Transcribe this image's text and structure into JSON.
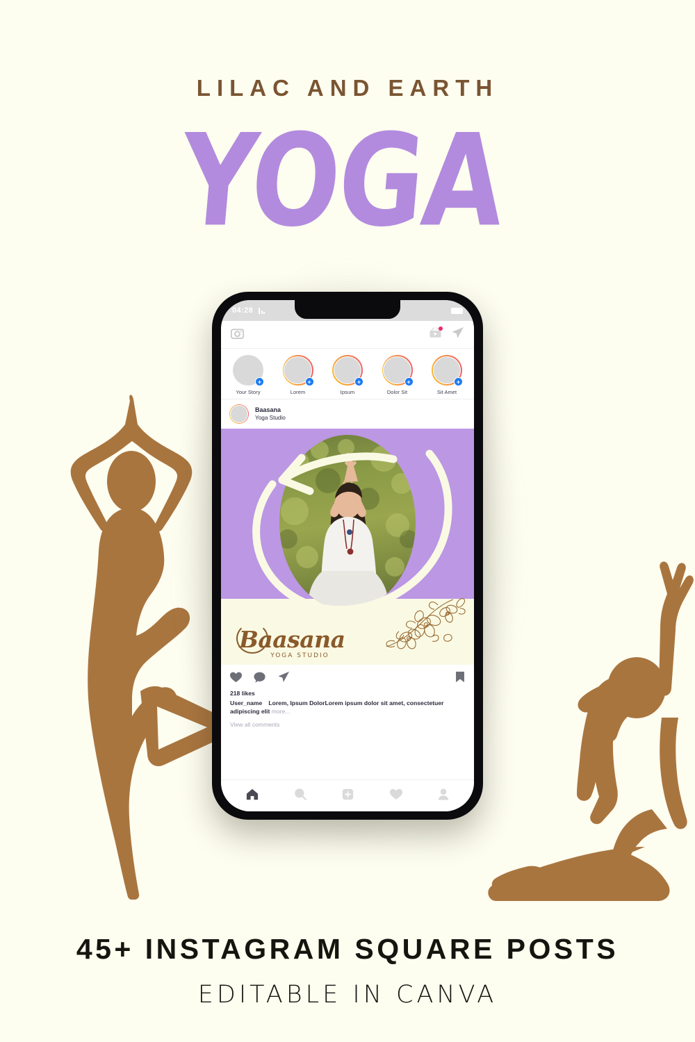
{
  "poster": {
    "kicker": "LILAC AND EARTH",
    "headline": "YOGA",
    "footer_main": "45+ INSTAGRAM SQUARE POSTS",
    "footer_sub": "EDITABLE IN CANVA",
    "colors": {
      "background": "#FDFDF0",
      "brown": "#7A5533",
      "lilac": "#B28BDE",
      "post_purple": "#BC97E4",
      "post_cream": "#FAFAE4",
      "silhouette": "#A9753F",
      "ink": "#15150F"
    }
  },
  "phone": {
    "status_bar": {
      "time": "04:28",
      "signal_icon": "signal-bars-icon",
      "battery_icon": "battery-icon"
    }
  },
  "instagram": {
    "top_bar": {
      "camera_icon": "camera-icon",
      "igtv_icon": "igtv-icon",
      "igtv_has_badge": true,
      "messenger_icon": "paper-plane-icon"
    },
    "stories": [
      {
        "label": "Your Story",
        "has_ring": false,
        "has_plus": true
      },
      {
        "label": "Lorem",
        "has_ring": true,
        "has_plus": true
      },
      {
        "label": "Ipsum",
        "has_ring": true,
        "has_plus": true
      },
      {
        "label": "Dolor Sit",
        "has_ring": true,
        "has_plus": true
      },
      {
        "label": "Sit Amet",
        "has_ring": true,
        "has_plus": true
      }
    ],
    "post": {
      "account_name": "Baasana",
      "account_subtitle": "Yoga Studio",
      "likes": "218 likes",
      "caption_user": "User_name",
      "caption_text": "Lorem, Ipsum DolorLorem ipsum dolor sit amet, consectetuer adipiscing elit",
      "caption_more": "more...",
      "view_comments": "View all comments",
      "brand_logo": "Baasana",
      "brand_logo_sub": "YOGA STUDIO",
      "photo_alt": "woman-in-white-meditating-outdoors",
      "actions": {
        "like_icon": "heart-icon",
        "comment_icon": "comment-bubble-icon",
        "share_icon": "paper-plane-icon",
        "save_icon": "bookmark-icon"
      }
    },
    "tab_bar": [
      {
        "icon": "home-icon",
        "active": true
      },
      {
        "icon": "search-icon",
        "active": false
      },
      {
        "icon": "add-post-icon",
        "active": false
      },
      {
        "icon": "heart-icon",
        "active": false
      },
      {
        "icon": "profile-icon",
        "active": false
      }
    ]
  }
}
